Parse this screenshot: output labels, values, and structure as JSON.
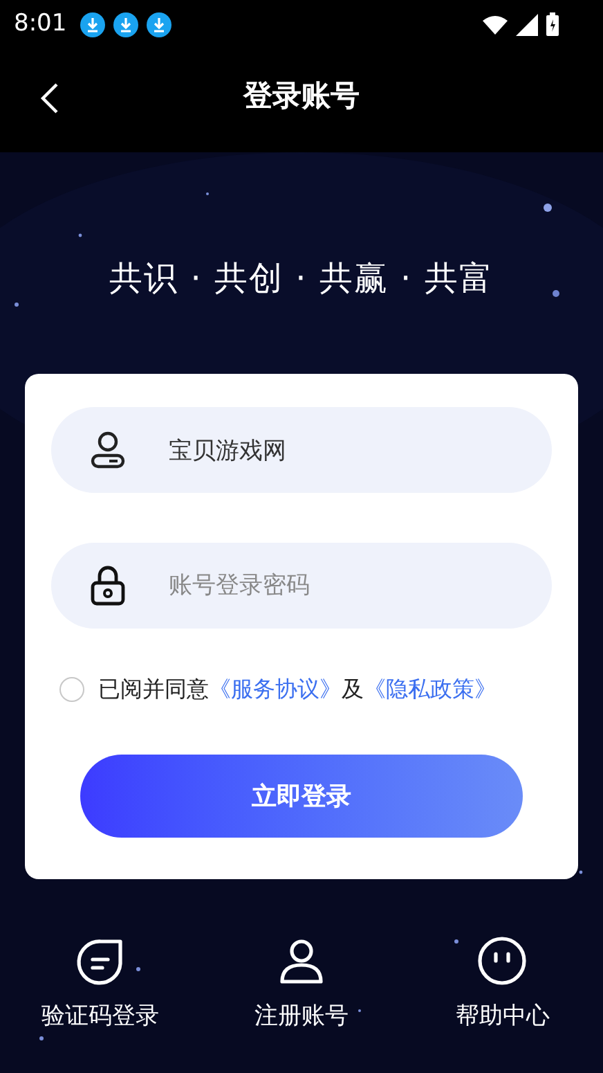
{
  "status_bar": {
    "time": "8:01",
    "notifications": [
      {
        "kind": "download"
      },
      {
        "kind": "download"
      },
      {
        "kind": "download"
      }
    ]
  },
  "header": {
    "title": "登录账号"
  },
  "slogan": "共识 · 共创 · 共赢 · 共富",
  "form": {
    "username": {
      "value": "宝贝游戏网"
    },
    "password": {
      "placeholder": "账号登录密码"
    },
    "agreement": {
      "checked": false,
      "text": "已阅并同意",
      "link1": "《服务协议》",
      "joiner": "及",
      "link2": "《隐私政策》"
    },
    "submit": "立即登录"
  },
  "shortcuts": [
    {
      "kind": "sms",
      "label": "验证码登录"
    },
    {
      "kind": "register",
      "label": "注册账号"
    },
    {
      "kind": "help",
      "label": "帮助中心"
    }
  ]
}
